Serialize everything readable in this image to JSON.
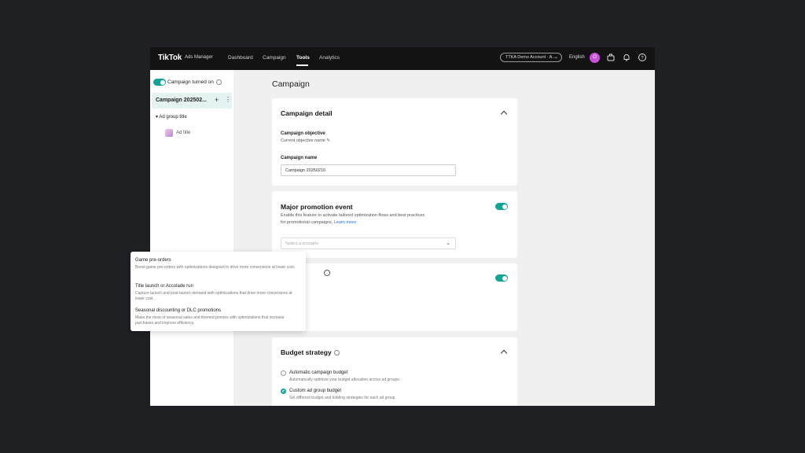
{
  "topbar": {
    "logo": "TikTok",
    "logo_sub": "Ads Manager",
    "nav": [
      "Dashboard",
      "Campaign",
      "Tools",
      "Analytics"
    ],
    "account": "TTKA Demo Account · A...",
    "language": "English",
    "avatar_initial": "O"
  },
  "sidebar": {
    "toggle_label": "Campaign turned on",
    "campaign_label": "Campaign 202502...",
    "plus": "+",
    "more": "⋮",
    "adgroup_label": "Ad group title",
    "ad_label": "Ad title"
  },
  "main": {
    "page_title": "Campaign",
    "campaign_detail": {
      "title": "Campaign detail",
      "objective_label": "Campaign objective",
      "objective_value": "Current objective name",
      "name_label": "Campaign name",
      "name_value": "Campaign 20250216"
    },
    "promotion": {
      "title": "Major promotion event",
      "desc_line1": "Enable this feature to activate tailored optimization flows and best practices",
      "desc_line2": "for promotional campaigns.",
      "learn_more": "Learn more",
      "select_placeholder": "Select a scenario"
    },
    "dropdown": [
      {
        "title": "Game pre-orders",
        "desc": "Boost game pre-orders with optimizations designed to drive more conversions at lower cost."
      },
      {
        "title": "Title launch or Accolade run",
        "desc": "Capture launch and post-launch demand with optimizations that drive more conversions at lower cost."
      },
      {
        "title": "Seasonal discounting or DLC promotions",
        "desc": "Make the most of seasonal sales and themed promos with optimizations that increase purchases and improve efficiency."
      }
    ],
    "budget": {
      "title": "Budget strategy",
      "option1_label": "Automatic campaign budget",
      "option1_desc": "Automatically optimize your budget allocation across ad groups.",
      "option2_label": "Custom ad group budget",
      "option2_desc": "Set different budget and bidding strategies for each ad group."
    }
  },
  "colors": {
    "accent": "#15a396",
    "topbar": "#131313",
    "avatar": "#c653d7"
  }
}
